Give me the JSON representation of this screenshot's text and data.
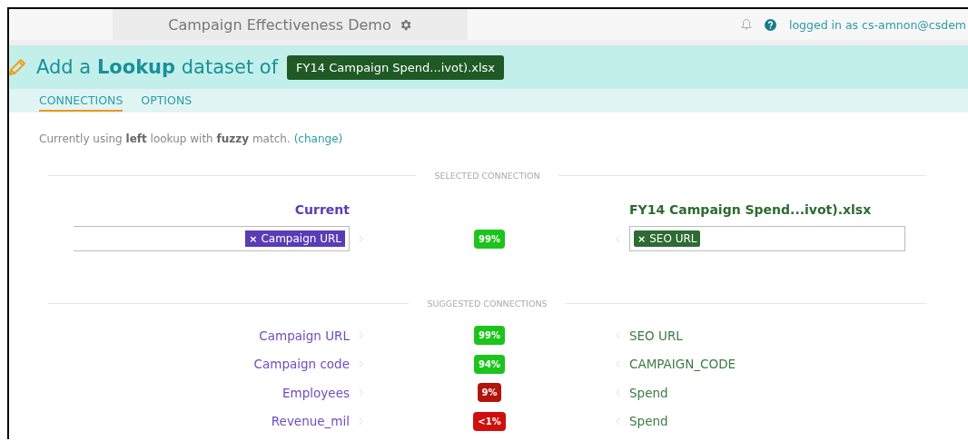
{
  "top_bar": {
    "project_title": "Campaign Effectiveness Demo",
    "user_text": "logged in as cs-amnon@csdem"
  },
  "header": {
    "title": "Add a **Lookup** dataset of",
    "dataset": "FY14 Campaign Spend...ivot).xlsx"
  },
  "tabs": [
    {
      "label": "CONNECTIONS",
      "selected": true
    },
    {
      "label": "OPTIONS",
      "selected": false
    }
  ],
  "info": {
    "text": "Currently using **left** lookup with **fuzzy** match.",
    "link": "(change)"
  },
  "selected_connection": {
    "heading": "SELECTED CONNECTION",
    "left_title": "Current",
    "left_tag": "Campaign URL",
    "match": "99%",
    "color": "#1cc41c",
    "right_title": "FY14 Campaign Spend...ivot).xlsx",
    "right_tag": "SEO URL",
    "tag_remove": "×"
  },
  "suggested_connections": {
    "heading": "SUGGESTED CONNECTIONS",
    "rows": [
      {
        "left": "Campaign URL",
        "match": "99%",
        "color": "#1cc41c",
        "right": "SEO URL"
      },
      {
        "left": "Campaign code",
        "match": "94%",
        "color": "#1cc41c",
        "right": "CAMPAIGN_CODE"
      },
      {
        "left": "Employees",
        "match": "9%",
        "color": "#b3140c",
        "right": "Spend"
      },
      {
        "left": "Revenue_mil",
        "match": "<1%",
        "color": "#d10f0f",
        "right": "Spend"
      }
    ]
  }
}
